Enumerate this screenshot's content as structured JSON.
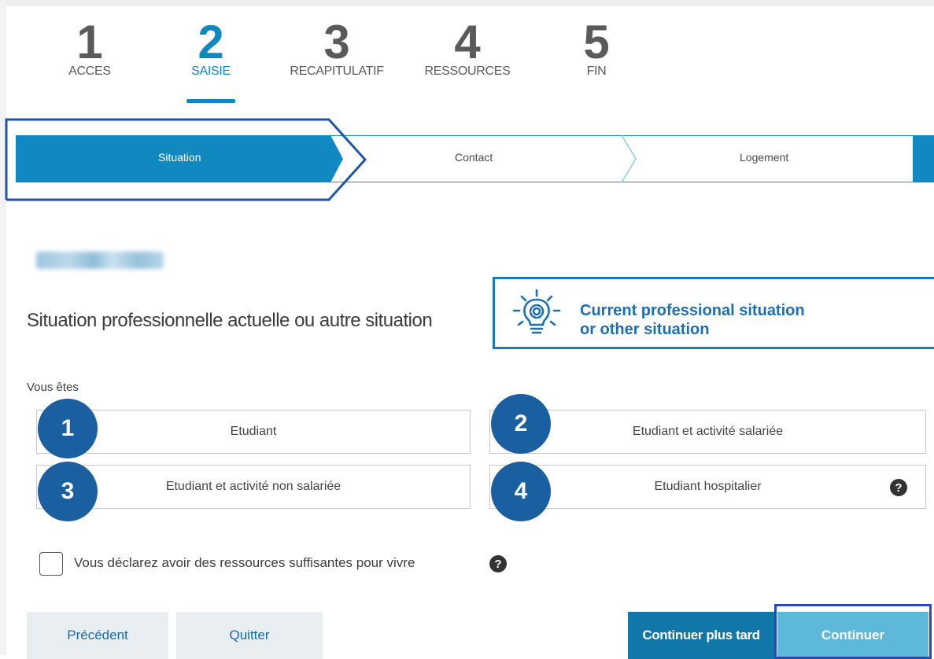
{
  "steps": [
    {
      "num": "1",
      "label": "ACCES"
    },
    {
      "num": "2",
      "label": "SAISIE"
    },
    {
      "num": "3",
      "label": "RECAPITULATIF"
    },
    {
      "num": "4",
      "label": "RESSOURCES"
    },
    {
      "num": "5",
      "label": "FIN"
    }
  ],
  "substeps": [
    "Situation",
    "Contact",
    "Logement"
  ],
  "section": {
    "question": "Situation professionnelle actuelle ou autre situation",
    "tip_line1": "Current professional situation",
    "tip_line2": "or other situation",
    "tip_icon": "lightbulb-gear-icon"
  },
  "form": {
    "vous_label": "Vous êtes",
    "options": [
      {
        "badge": "1",
        "label": "Etudiant"
      },
      {
        "badge": "2",
        "label": "Etudiant et activité salariée"
      },
      {
        "badge": "3",
        "label": "Etudiant et activité non salariée"
      },
      {
        "badge": "4",
        "label": "Etudiant hospitalier"
      }
    ],
    "help_glyph": "?",
    "checkbox_label": "Vous déclarez avoir des ressources suffisantes pour vivre"
  },
  "buttons": {
    "precedent": "Précédent",
    "quitter": "Quitter",
    "continuer_plus_tard": "Continuer plus tard",
    "continuer": "Continuer"
  },
  "colors": {
    "accent": "#1189c0",
    "badge": "#1a5fa0",
    "tip_border": "#1b79ba",
    "highlight_frame": "#2e47b8"
  }
}
